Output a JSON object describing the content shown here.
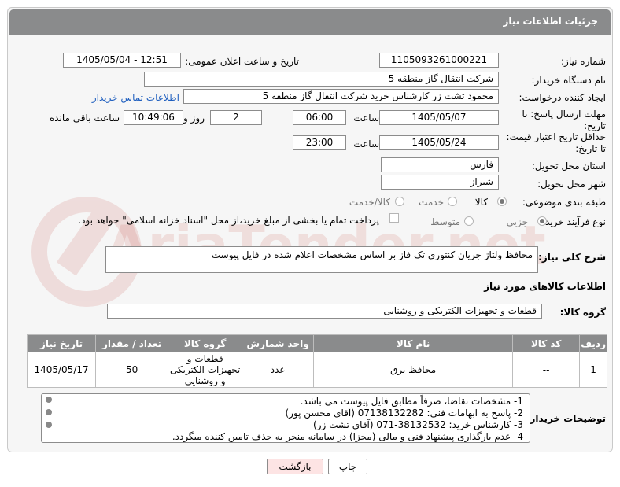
{
  "header": {
    "title": "جزئیات اطلاعات نیاز"
  },
  "fields": {
    "need_number_label": "شماره نیاز:",
    "need_number": "1105093261000221",
    "announce_label": "تاریخ و ساعت اعلان عمومی:",
    "announce_value": "1405/05/04 - 12:51",
    "buyer_org_label": "نام دستگاه خریدار:",
    "buyer_org": "شرکت انتقال گاز منطقه 5",
    "creator_label": "ایجاد کننده درخواست:",
    "creator": "محمود تشت زر کارشناس خرید شرکت انتقال گاز منطقه 5",
    "contact_link": "اطلاعات تماس خریدار",
    "deadline_label": "مهلت ارسال پاسخ: تا تاریخ:",
    "deadline_date": "1405/05/07",
    "time_label": "ساعت",
    "deadline_time": "06:00",
    "days_value": "2",
    "days_label": "روز و",
    "remaining_time": "10:49:06",
    "remaining_label": "ساعت باقی مانده",
    "price_valid_label": "حداقل تاریخ اعتبار قیمت: تا تاریخ:",
    "price_valid_date": "1405/05/24",
    "price_valid_time_label": "ساعت",
    "price_valid_time": "23:00",
    "province_label": "استان محل تحویل:",
    "province": "فارس",
    "city_label": "شهر محل تحویل:",
    "city": "شیراز",
    "category_label": "طبقه بندی موضوعی:",
    "category_options": [
      "کالا",
      "خدمت",
      "کالا/خدمت"
    ],
    "category_selected": "کالا",
    "process_label": "نوع فرآیند خرید :",
    "process_options": [
      "جزیی",
      "متوسط"
    ],
    "process_selected": "جزیی",
    "payment_note": "پرداخت تمام یا بخشی از مبلغ خرید،از محل \"اسناد خزانه اسلامی\" خواهد بود."
  },
  "description": {
    "label": "شرح کلی نیاز:",
    "text": "محافظ ولتاژ جریان کنتوری تک فاز بر اساس مشخصات اعلام شده در فایل پیوست"
  },
  "goods_section": {
    "title": "اطلاعات کالاهای مورد نیاز",
    "group_label": "گروه کالا:",
    "group_value": "قطعات و تجهیزات الکتریکی و روشنایی"
  },
  "table": {
    "headers": [
      "ردیف",
      "کد کالا",
      "نام کالا",
      "واحد شمارش",
      "گروه کالا",
      "تعداد / مقدار",
      "تاریخ نیاز"
    ],
    "rows": [
      [
        "1",
        "--",
        "محافظ برق",
        "عدد",
        "قطعات و تجهیزات الکتریکی و روشنایی",
        "50",
        "1405/05/17"
      ]
    ]
  },
  "buyer_notes": {
    "label": "توضیحات خریدار:",
    "lines": [
      "1-  مشخصات تقاضا، صرفاً مطابق فایل پیوست می باشد.",
      "2- پاسخ به ابهامات فنی: 07138132282 (آقای محسن پور)",
      "3- کارشناس خرید: 38132532-071 (آقای تشت زر)",
      "4- عدم بارگذاری پیشنهاد فنی و مالی (مجزا) در سامانه منجر به حذف تامین کننده میگردد."
    ]
  },
  "buttons": {
    "print": "چاپ",
    "back": "بازگشت"
  },
  "watermark": {
    "text": "AriaTender.net"
  },
  "colors": {
    "header_bg": "#8a8b8c",
    "link": "#1f5fbf",
    "back_button_bg": "#fde4e4"
  }
}
